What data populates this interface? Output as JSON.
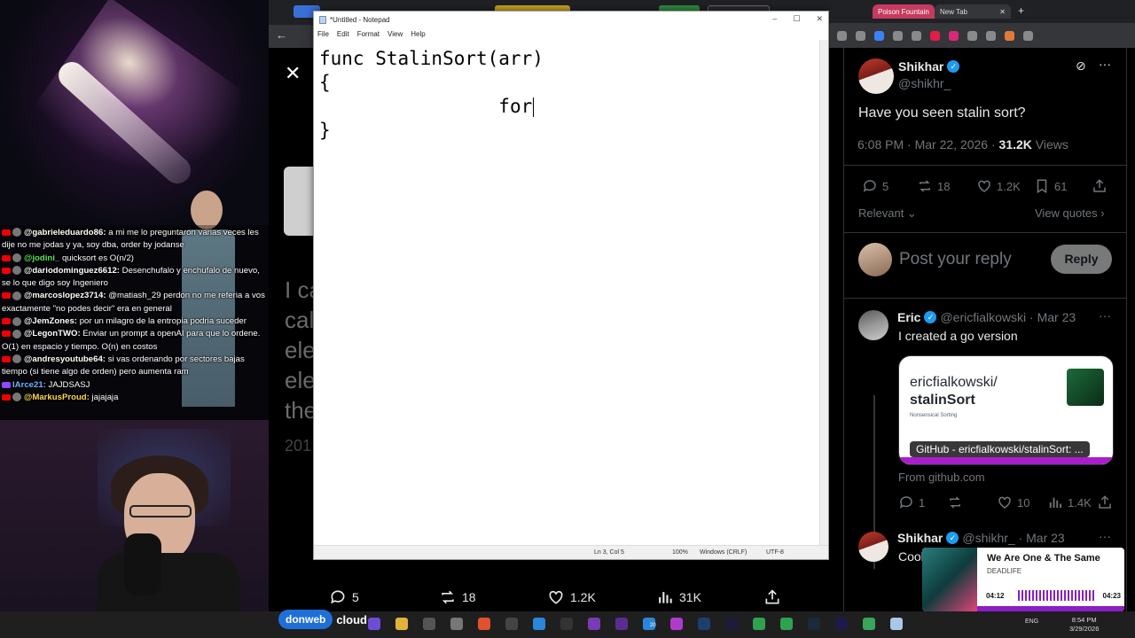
{
  "stream": {
    "chat": [
      {
        "user": "@gabrieleduardo86:",
        "text": "a mi me lo preguntaron varias veces les dije no me jodas y ya, soy dba, order by jodanse",
        "color": "white"
      },
      {
        "user": "@jodini_",
        "text": "quicksort es O(n/2)",
        "color": "green"
      },
      {
        "user": "@dariodominguez6612:",
        "text": "Desenchufalo y enchufalo de nuevo, se lo que digo soy Ingeniero",
        "color": "white"
      },
      {
        "user": "@marcoslopez3714:",
        "text": "@matiash_29 perdon no me referia a vos exactamente \"no podes decir\" era en general",
        "color": "white"
      },
      {
        "user": "@JemZones:",
        "text": "por un milagro de la entropia podria suceder",
        "color": "white"
      },
      {
        "user": "@LegonTWO:",
        "text": "Enviar un prompt a openAI para que lo ordene. O(1) en espacio y tiempo. O(n) en costos",
        "color": "white"
      },
      {
        "user": "@andresyoutube64:",
        "text": "si vas ordenando por sectores bajas tiempo (si tiene algo de orden) pero aumenta ram",
        "color": "white"
      },
      {
        "user": "lArce21:",
        "text": "JAJDSASJ",
        "color": "blue"
      },
      {
        "user": "@MarkusProud:",
        "text": "jajajaja",
        "color": "yellow"
      }
    ],
    "sponsor": {
      "pill": "donweb",
      "suffix": "cloud"
    }
  },
  "viewer": {
    "close_glyph": "✕",
    "back_glyph": "←",
    "blurred_lines": [
      "I ca",
      "cal",
      "ele",
      "ele",
      "the"
    ],
    "blurred_year": "201",
    "actions": {
      "replies": "5",
      "reposts": "18",
      "likes": "1.2K",
      "views": "31K"
    }
  },
  "notepad": {
    "title": "*Untitled - Notepad",
    "menu": [
      "File",
      "Edit",
      "Format",
      "View",
      "Help"
    ],
    "lines": [
      "func StalinSort(arr)",
      "{",
      "\t\tfor",
      "}"
    ],
    "status": {
      "position": "Ln 3, Col 5",
      "zoom": "100%",
      "eol": "Windows (CRLF)",
      "encoding": "UTF-8"
    },
    "win_buttons": [
      "–",
      "☐",
      "✕"
    ]
  },
  "browser": {
    "tabs": [
      {
        "label": "Poison Fountain"
      },
      {
        "label": "New Tab"
      }
    ],
    "new_tab_glyph": "+"
  },
  "thread": {
    "main": {
      "name": "Shikhar",
      "handle": "@shikhr_",
      "text": "Have you seen stalin sort?",
      "time": "6:08 PM · Mar 22, 2026 · ",
      "views_count": "31.2K",
      "views_label": " Views",
      "replies": "5",
      "reposts": "18",
      "likes": "1.2K",
      "bookmarks": "61",
      "relevant": "Relevant",
      "view_quotes": "View quotes"
    },
    "reply_prompt": "Post your reply",
    "reply_button": "Reply",
    "eric": {
      "name": "Eric",
      "handle": "@ericfialkowski · Mar 23",
      "text": "I created a go version",
      "card_owner": "ericfialkowski/",
      "card_repo": "stalinSort",
      "card_desc": "Nonsensical Sorting",
      "card_title": "GitHub - ericfialkowski/stalinSort: ...",
      "from": "From github.com",
      "replies": "1",
      "likes": "10",
      "views": "1.4K"
    },
    "reply2": {
      "name": "Shikhar",
      "handle": "@shikhr_ · Mar 23",
      "text": "Cool"
    }
  },
  "media": {
    "song": "We Are One & The Same",
    "artist": "DEADLIFE",
    "elapsed": "04:12",
    "total": "04:23"
  },
  "taskbar": {
    "tray_lang": "ENG",
    "time": "8:54 PM",
    "date": "3/29/2026",
    "badge": "20"
  }
}
